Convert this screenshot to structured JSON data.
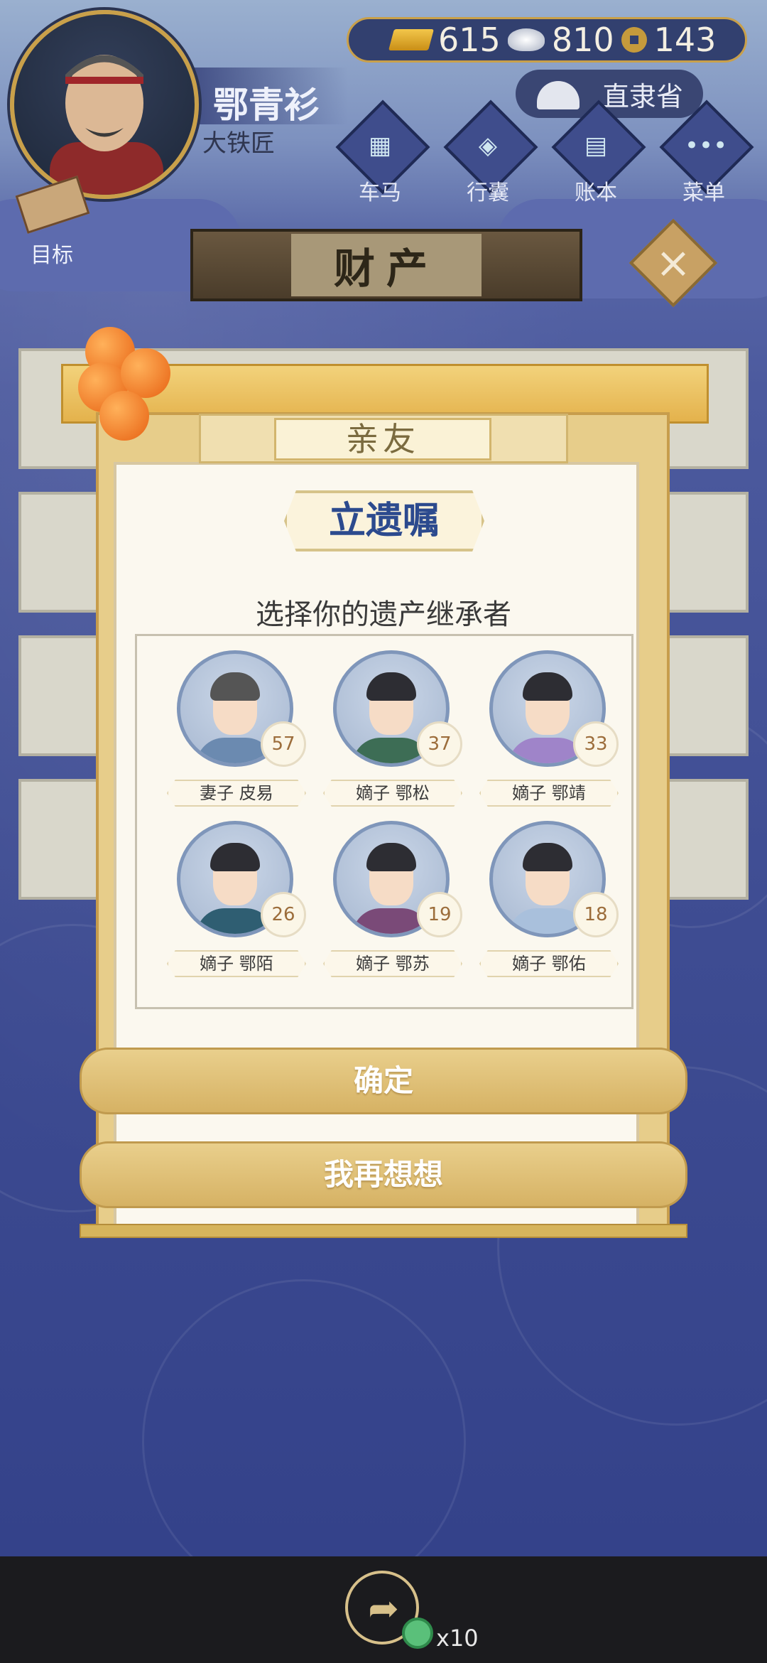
{
  "player": {
    "name": "鄂青衫",
    "title": "大铁匠"
  },
  "currency": {
    "gold": "615",
    "silver": "810",
    "coin": "143"
  },
  "location": {
    "province": "直隶省"
  },
  "top_menu": [
    {
      "label": "车马",
      "icon": "cart-icon"
    },
    {
      "label": "行囊",
      "icon": "bag-icon"
    },
    {
      "label": "账本",
      "icon": "ledger-icon"
    },
    {
      "label": "菜单",
      "icon": "menu-icon"
    }
  ],
  "goal": {
    "label": "目标"
  },
  "section": {
    "title": "财产"
  },
  "modal": {
    "tab": "亲友",
    "title": "立遗嘱",
    "subtitle": "选择你的遗产继承者",
    "heirs": [
      {
        "label": "妻子 皮易",
        "age": "57"
      },
      {
        "label": "嫡子 鄂松",
        "age": "37"
      },
      {
        "label": "嫡子 鄂靖",
        "age": "33"
      },
      {
        "label": "嫡子 鄂陌",
        "age": "26"
      },
      {
        "label": "嫡子 鄂苏",
        "age": "19"
      },
      {
        "label": "嫡子 鄂佑",
        "age": "18"
      }
    ],
    "confirm_label": "确定",
    "rethink_label": "我再想想"
  },
  "share": {
    "count": "x10"
  },
  "colors": {
    "accent_gold": "#d6b264",
    "title_blue": "#2c4a8e",
    "background": "#3e4c92"
  }
}
